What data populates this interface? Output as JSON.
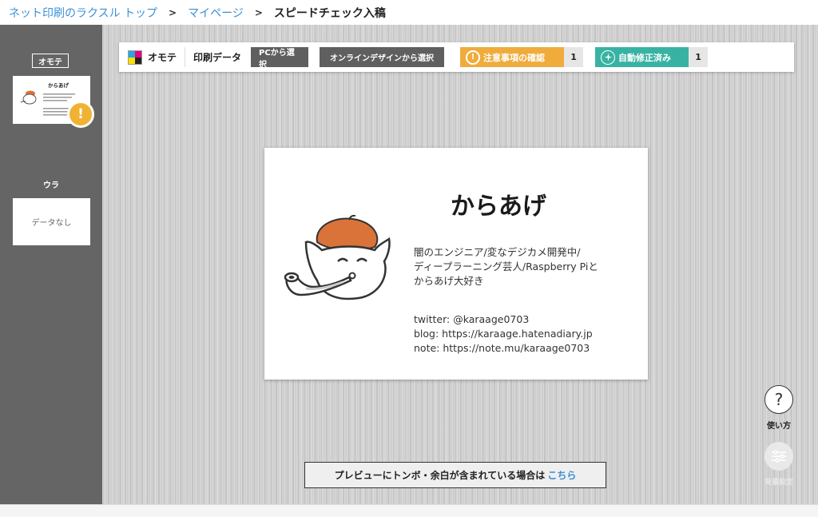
{
  "breadcrumb": {
    "items": [
      "ネット印刷のラクスル トップ",
      "マイページ"
    ],
    "separator": ">",
    "current": "スピードチェック入稿"
  },
  "sidebar": {
    "front_label": "オモテ",
    "back_label": "ウラ",
    "back_empty_text": "データなし",
    "front_warning_icon": "!"
  },
  "toolbar": {
    "side_name": "オモテ",
    "data_label": "印刷データ",
    "pc_select": "PCから選択",
    "online_design_select": "オンラインデザインから選択",
    "warning_label": "注意事項の確認",
    "warning_count": "1",
    "warning_icon": "!",
    "auto_fix_label": "自動修正済み",
    "auto_fix_count": "1",
    "colors": {
      "warning": "#efac3c",
      "auto_fix": "#38b3a3"
    }
  },
  "card": {
    "name": "からあげ",
    "description": [
      "闇のエンジニア/変なデジカメ開発中/",
      "ディープラーニング芸人/Raspberry Piと",
      "からあげ大好き"
    ],
    "links": [
      "twitter: @karaage0703",
      "blog: https://karaage.hatenadiary.jp",
      "note: https://note.mu/karaage0703"
    ],
    "mini_name": "からあげ"
  },
  "notice": {
    "text": "プレビューにトンボ・余白が含まれている場合は",
    "link": "こちら"
  },
  "help": {
    "icon": "?",
    "label": "使い方"
  },
  "settings": {
    "label": "背景設定"
  }
}
